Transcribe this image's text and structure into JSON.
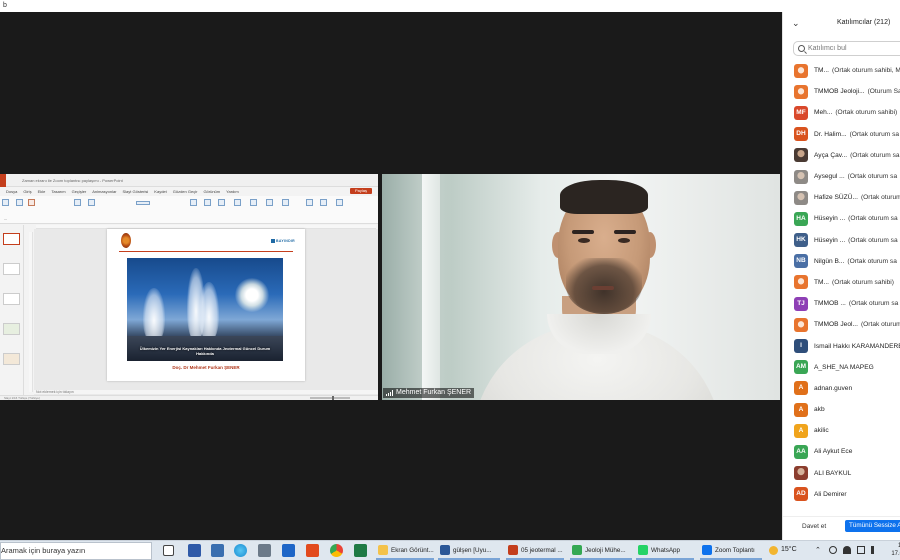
{
  "top_bar": {
    "label": "b"
  },
  "share": {
    "window_title": "Zaman ekranı ile Zoom toplantısı paylaşımı - PowerPoint",
    "share_button": "Paylaş",
    "ribbon_tabs": [
      "Dosya",
      "Giriş",
      "Ekle",
      "Tasarım",
      "Geçişler",
      "Animasyonlar",
      "Slayt Gösterisi",
      "Kaydet",
      "Gözden Geçir",
      "Görünüm",
      "Yardım"
    ],
    "slide_logo_right": "BAYINDIR",
    "slide_caption": "Ülkemizin Yer Enerjisi Kaynakları Hakkında Jeotermal Güncel Durum Hakkında",
    "slide_author": "Doç. Dr Mehmet Furkan ŞENER",
    "notes_placeholder": "Not eklemek için tıklayın",
    "status_text": "Slayt 1/16  Türkçe (Türkiye)"
  },
  "video": {
    "participant_name": "Mehmet Furkan ŞENER"
  },
  "panel": {
    "title": "Katılımcılar (212)",
    "search_placeholder": "Katılımcı bul",
    "participants": [
      {
        "name": "TM...",
        "role": "(Ortak oturum sahibi, M",
        "initials": "",
        "style": "photo-orange"
      },
      {
        "name": "TMMOB Jeoloji...",
        "role": "(Oturum Sa",
        "initials": "",
        "style": "photo-orange"
      },
      {
        "name": "Meh...",
        "role": "(Ortak oturum sahibi)",
        "initials": "MF",
        "style": "",
        "color": "#d9482b"
      },
      {
        "name": "Dr. Halim...",
        "role": "(Ortak oturum sa",
        "initials": "DH",
        "style": "",
        "color": "#d9531e"
      },
      {
        "name": "Ayça Çav...",
        "role": "(Ortak oturum sa",
        "initials": "",
        "style": "photo-dark"
      },
      {
        "name": "Aysegul ...",
        "role": "(Ortak oturum sa",
        "initials": "",
        "style": "photo-grey"
      },
      {
        "name": "Hafize SÜZÜ...",
        "role": "(Ortak oturum",
        "initials": "",
        "style": "photo-grey"
      },
      {
        "name": "Hüseyin ...",
        "role": "(Ortak oturum sa",
        "initials": "HA",
        "style": "",
        "color": "#3aa655"
      },
      {
        "name": "Hüseyin ...",
        "role": "(Ortak oturum sa",
        "initials": "HK",
        "style": "",
        "color": "#3f5f8a"
      },
      {
        "name": "Nilgün B...",
        "role": "(Ortak oturum sa",
        "initials": "NB",
        "style": "",
        "color": "#4a6fa5"
      },
      {
        "name": "TM...",
        "role": "(Ortak oturum sahibi)",
        "initials": "",
        "style": "photo-orange"
      },
      {
        "name": "TMMOB ...",
        "role": "(Ortak oturum sa",
        "initials": "TJ",
        "style": "",
        "color": "#8e3fb5"
      },
      {
        "name": "TMMOB Jeol...",
        "role": "(Ortak oturum",
        "initials": "",
        "style": "photo-orange"
      },
      {
        "name": "Ismail Hakkı KARAMANDERES",
        "role": "",
        "initials": "I",
        "style": "",
        "color": "#2f4e7a"
      },
      {
        "name": "A_SHE_NA MAPEG",
        "role": "",
        "initials": "AM",
        "style": "",
        "color": "#3aa655"
      },
      {
        "name": "adnan.guven",
        "role": "",
        "initials": "A",
        "style": "",
        "color": "#e0701a"
      },
      {
        "name": "akb",
        "role": "",
        "initials": "A",
        "style": "",
        "color": "#e0701a"
      },
      {
        "name": "akilic",
        "role": "",
        "initials": "A",
        "style": "",
        "color": "#f0a41c"
      },
      {
        "name": "Ali Aykut Ece",
        "role": "",
        "initials": "AA",
        "style": "",
        "color": "#3aa655"
      },
      {
        "name": "ALI BAYKUL",
        "role": "",
        "initials": "",
        "style": "photo-red"
      },
      {
        "name": "Ali Demirer",
        "role": "",
        "initials": "AD",
        "style": "",
        "color": "#d9531e"
      }
    ],
    "invite_button": "Davet et",
    "mute_all_button": "Tümünü Sessize Al"
  },
  "taskbar": {
    "search_placeholder": "Aramak için buraya yazın",
    "apps": [
      {
        "label": "Ekran Görünt...",
        "color": "#f4c24a"
      },
      {
        "label": "gülşen [Uyu...",
        "color": "#2b5797"
      },
      {
        "label": "05 jeotermal ...",
        "color": "#c43e1c"
      },
      {
        "label": "Jeoloji Mühe...",
        "color": "#34a853"
      },
      {
        "label": "WhatsApp",
        "color": "#25d366"
      },
      {
        "label": "Zoom Toplantı",
        "color": "#0e72ed"
      }
    ],
    "temperature": "15°C",
    "time": "1:",
    "date": "17.0"
  }
}
